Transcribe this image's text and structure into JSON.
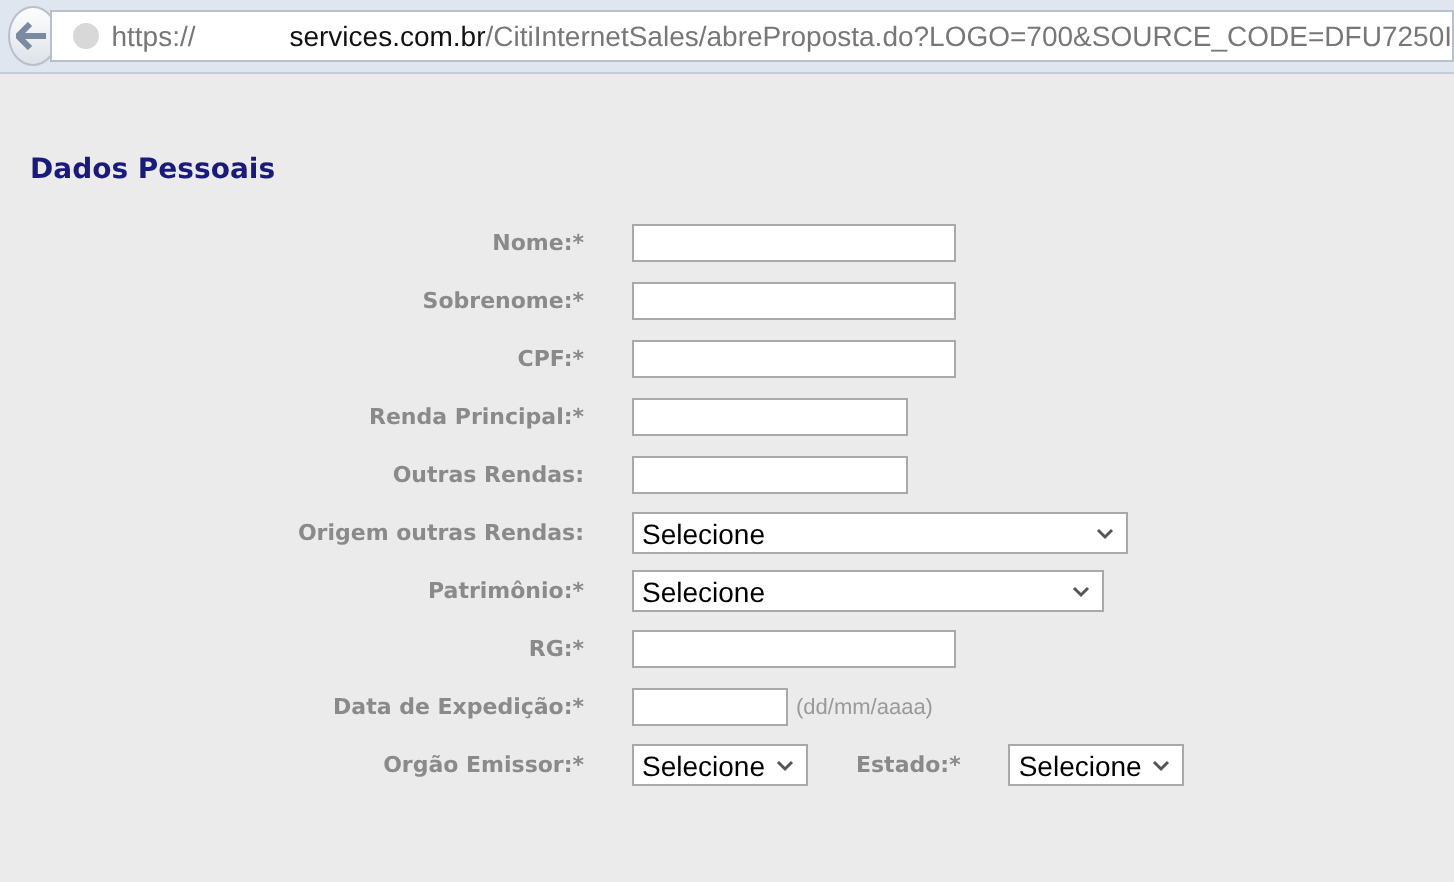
{
  "address_bar": {
    "scheme": "https://",
    "host": "services.com.br",
    "path": "/CitiInternetSales/abreProposta.do?LOGO=700&SOURCE_CODE=DFU7250I"
  },
  "section_title": "Dados Pessoais",
  "rows": [
    {
      "label": "Nome:*",
      "fields": [
        {
          "kind": "text"
        }
      ]
    },
    {
      "label": "Sobrenome:*",
      "fields": [
        {
          "kind": "text"
        }
      ]
    },
    {
      "label": "CPF:*",
      "fields": [
        {
          "kind": "text"
        }
      ]
    },
    {
      "label": "Renda Principal:*",
      "fields": [
        {
          "kind": "amount"
        }
      ]
    },
    {
      "label": "Outras Rendas:",
      "fields": [
        {
          "kind": "amount"
        }
      ]
    },
    {
      "label": "Origem outras Rendas:",
      "fields": [
        {
          "kind": "select",
          "value": "Selecione"
        }
      ]
    },
    {
      "label": "Patrimônio:*",
      "fields": [
        {
          "kind": "select",
          "value": "Selecione"
        }
      ]
    },
    {
      "label": "RG:*",
      "fields": [
        {
          "kind": "text"
        }
      ]
    },
    {
      "label": "Data de Expedição:*",
      "fields": [
        {
          "kind": "date",
          "hint": "(dd/mm/aaaa)"
        }
      ]
    },
    {
      "label": "Orgão Emissor:*",
      "fields": [
        {
          "kind": "small-select",
          "value": "Selecione"
        },
        {
          "kind": "small-select",
          "label": "Estado:*",
          "value": "Selecione"
        }
      ]
    }
  ]
}
